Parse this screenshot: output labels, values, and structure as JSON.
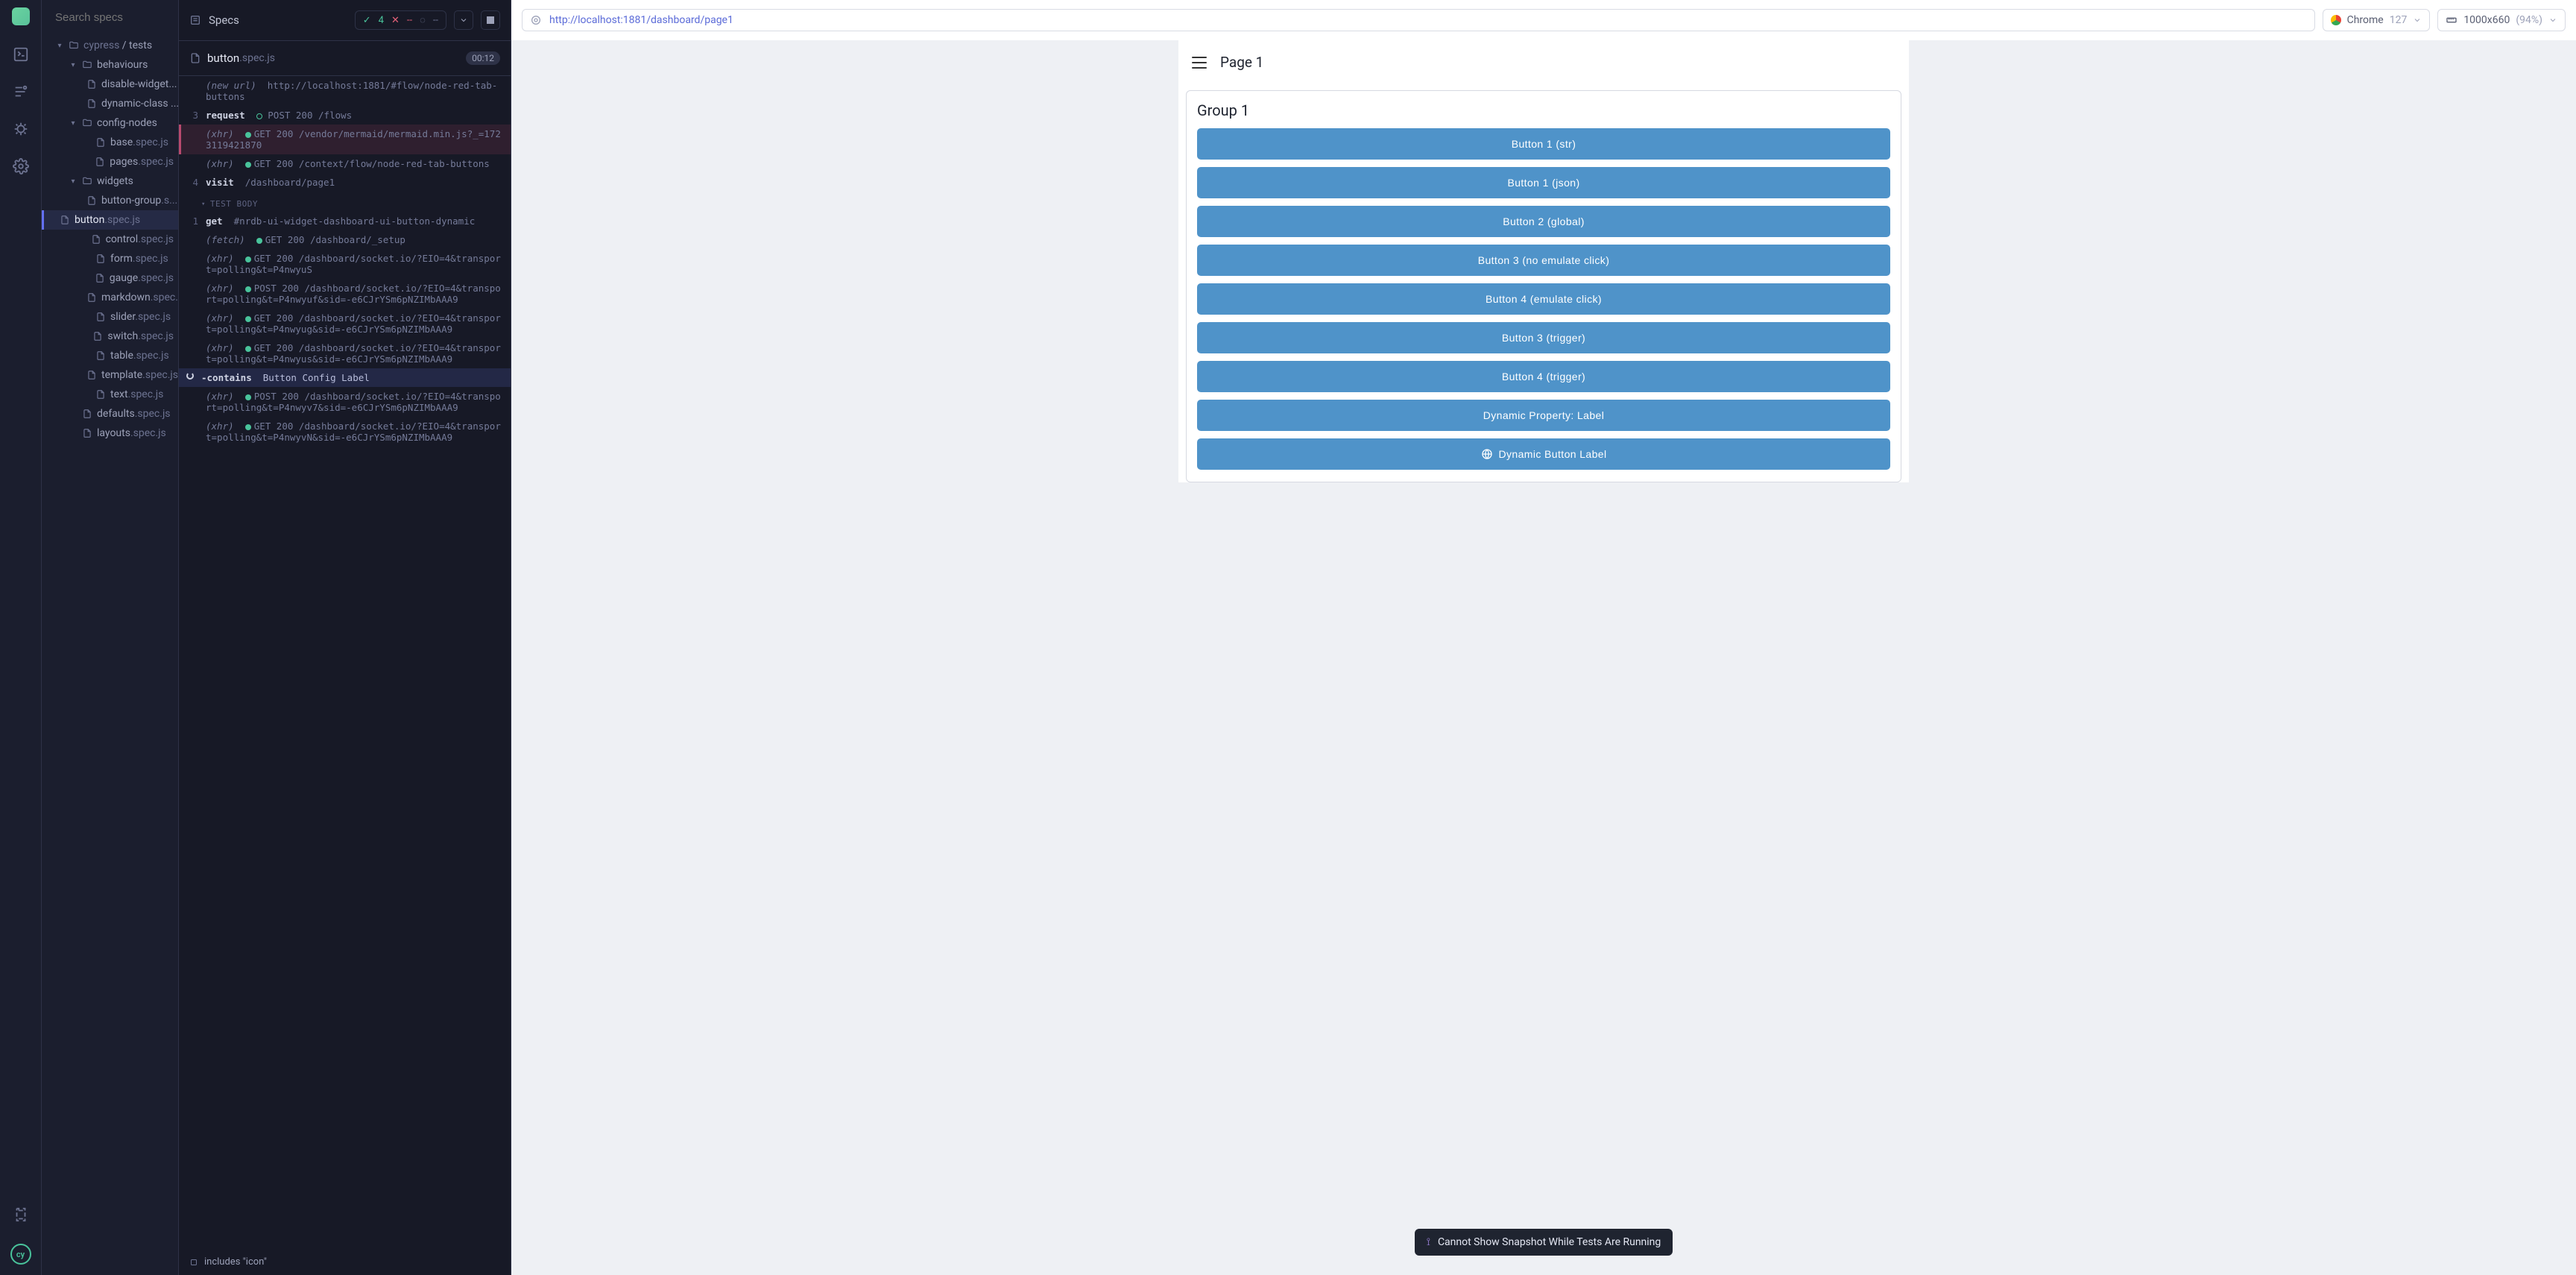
{
  "search": {
    "placeholder": "Search specs"
  },
  "tree": {
    "root_a": "cypress",
    "root_b": "tests",
    "nodes": [
      {
        "t": "folder",
        "l": "behaviours",
        "d": 2
      },
      {
        "t": "file",
        "n": "disable-widget...",
        "e": "",
        "d": 3
      },
      {
        "t": "file",
        "n": "dynamic-class ...",
        "e": "",
        "d": 3
      },
      {
        "t": "folder",
        "l": "config-nodes",
        "d": 2
      },
      {
        "t": "file",
        "n": "base",
        "e": ".spec.js",
        "d": 3
      },
      {
        "t": "file",
        "n": "pages",
        "e": ".spec.js",
        "d": 3
      },
      {
        "t": "folder",
        "l": "widgets",
        "d": 2
      },
      {
        "t": "file",
        "n": "button-group",
        "e": ".s...",
        "d": 3
      },
      {
        "t": "file",
        "n": "button",
        "e": ".spec.js",
        "d": 3,
        "sel": true
      },
      {
        "t": "file",
        "n": "control",
        "e": ".spec.js",
        "d": 3
      },
      {
        "t": "file",
        "n": "form",
        "e": ".spec.js",
        "d": 3
      },
      {
        "t": "file",
        "n": "gauge",
        "e": ".spec.js",
        "d": 3
      },
      {
        "t": "file",
        "n": "markdown",
        "e": ".spec....",
        "d": 3
      },
      {
        "t": "file",
        "n": "slider",
        "e": ".spec.js",
        "d": 3
      },
      {
        "t": "file",
        "n": "switch",
        "e": ".spec.js",
        "d": 3
      },
      {
        "t": "file",
        "n": "table",
        "e": ".spec.js",
        "d": 3
      },
      {
        "t": "file",
        "n": "template",
        "e": ".spec.js",
        "d": 3
      },
      {
        "t": "file",
        "n": "text",
        "e": ".spec.js",
        "d": 3
      },
      {
        "t": "file",
        "n": "defaults",
        "e": ".spec.js",
        "d": 2
      },
      {
        "t": "file",
        "n": "layouts",
        "e": ".spec.js",
        "d": 2
      }
    ]
  },
  "runner": {
    "header": "Specs",
    "stats": {
      "pass": "4",
      "fail": "--",
      "pend": "--"
    },
    "spec_name": "button",
    "spec_ext": ".spec.js",
    "time": "00:12",
    "log": [
      {
        "num": "",
        "kind": "tag",
        "tag": "(new url)",
        "rest": "http://localhost:1881/#flow/node-red-tab-buttons"
      },
      {
        "num": "3",
        "kind": "req",
        "kw": "request",
        "dot": "hollow",
        "meth": "POST 200",
        "path": "/flows"
      },
      {
        "num": "",
        "kind": "xhr",
        "tag": "(xhr)",
        "meth": "GET 200",
        "path": "/vendor/mermaid/mermaid.min.js?_=1723119421870",
        "hl": "err"
      },
      {
        "num": "",
        "kind": "xhr",
        "tag": "(xhr)",
        "meth": "GET 200",
        "path": "/context/flow/node-red-tab-buttons"
      },
      {
        "num": "4",
        "kind": "cmd",
        "kw": "visit",
        "rest": "/dashboard/page1"
      },
      {
        "kind": "section",
        "label": "TEST BODY"
      },
      {
        "num": "1",
        "kind": "cmd",
        "kw": "get",
        "rest": "#nrdb-ui-widget-dashboard-ui-button-dynamic"
      },
      {
        "num": "",
        "kind": "xhr",
        "tag": "(fetch)",
        "meth": "GET 200",
        "path": "/dashboard/_setup"
      },
      {
        "num": "",
        "kind": "xhr",
        "tag": "(xhr)",
        "meth": "GET 200",
        "path": "/dashboard/socket.io/?EIO=4&transport=polling&t=P4nwyuS"
      },
      {
        "num": "",
        "kind": "xhr",
        "tag": "(xhr)",
        "meth": "POST 200",
        "path": "/dashboard/socket.io/?EIO=4&transport=polling&t=P4nwyuf&sid=-e6CJrYSm6pNZIMbAAA9"
      },
      {
        "num": "",
        "kind": "xhr",
        "tag": "(xhr)",
        "meth": "GET 200",
        "path": "/dashboard/socket.io/?EIO=4&transport=polling&t=P4nwyug&sid=-e6CJrYSm6pNZIMbAAA9"
      },
      {
        "num": "",
        "kind": "xhr",
        "tag": "(xhr)",
        "meth": "GET 200",
        "path": "/dashboard/socket.io/?EIO=4&transport=polling&t=P4nwyus&sid=-e6CJrYSm6pNZIMbAAA9"
      },
      {
        "num": "",
        "kind": "run",
        "kw": "-contains",
        "rest": "Button Config Label",
        "hl": "active"
      },
      {
        "num": "",
        "kind": "xhr",
        "tag": "(xhr)",
        "meth": "POST 200",
        "path": "/dashboard/socket.io/?EIO=4&transport=polling&t=P4nwyv7&sid=-e6CJrYSm6pNZIMbAAA9"
      },
      {
        "num": "",
        "kind": "xhr",
        "tag": "(xhr)",
        "meth": "GET 200",
        "path": "/dashboard/socket.io/?EIO=4&transport=polling&t=P4nwyvN&sid=-e6CJrYSm6pNZIMbAAA9"
      }
    ],
    "next_test": "includes \"icon\""
  },
  "preview": {
    "url": "http://localhost:1881/dashboard/page1",
    "browser": "Chrome",
    "browser_ver": "127",
    "dims": "1000x660",
    "zoom": "(94%)",
    "page_title": "Page 1",
    "group_title": "Group 1",
    "buttons": [
      "Button 1 (str)",
      "Button 1 (json)",
      "Button 2 (global)",
      "Button 3 (no emulate click)",
      "Button 4 (emulate click)",
      "Button 3 (trigger)",
      "Button 4 (trigger)",
      "Dynamic Property: Label"
    ],
    "dynamic_button": "Dynamic Button Label",
    "toast": "Cannot Show Snapshot While Tests Are Running"
  }
}
